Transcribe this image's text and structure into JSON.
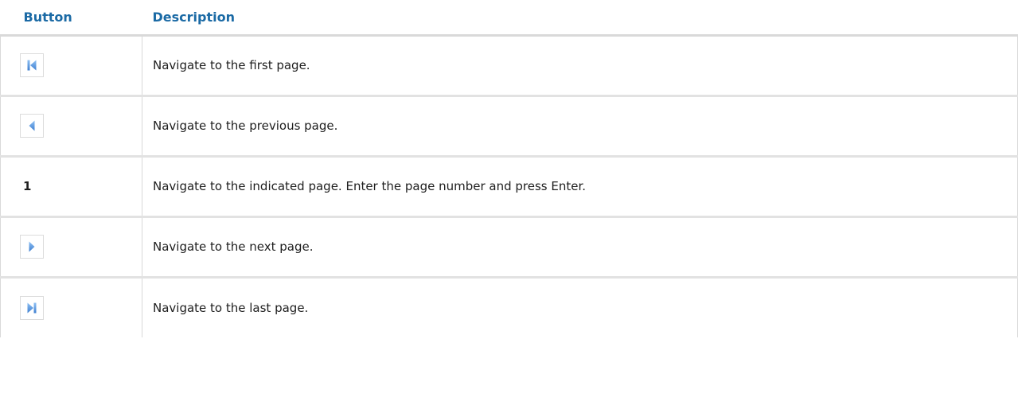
{
  "table": {
    "headers": {
      "button": "Button",
      "description": "Description"
    },
    "rows": [
      {
        "button_icon": "first-page-icon",
        "description": "Navigate to the first page."
      },
      {
        "button_icon": "previous-page-icon",
        "description": "Navigate to the previous page."
      },
      {
        "button_text": "1",
        "description": "Navigate to the indicated page. Enter the page number and press Enter."
      },
      {
        "button_icon": "next-page-icon",
        "description": "Navigate to the next page."
      },
      {
        "button_icon": "last-page-icon",
        "description": "Navigate to the last page."
      }
    ]
  },
  "colors": {
    "header_text": "#1b6aa5",
    "icon_blue": "#4a8fdc",
    "row_divider": "#e2e2e2"
  }
}
